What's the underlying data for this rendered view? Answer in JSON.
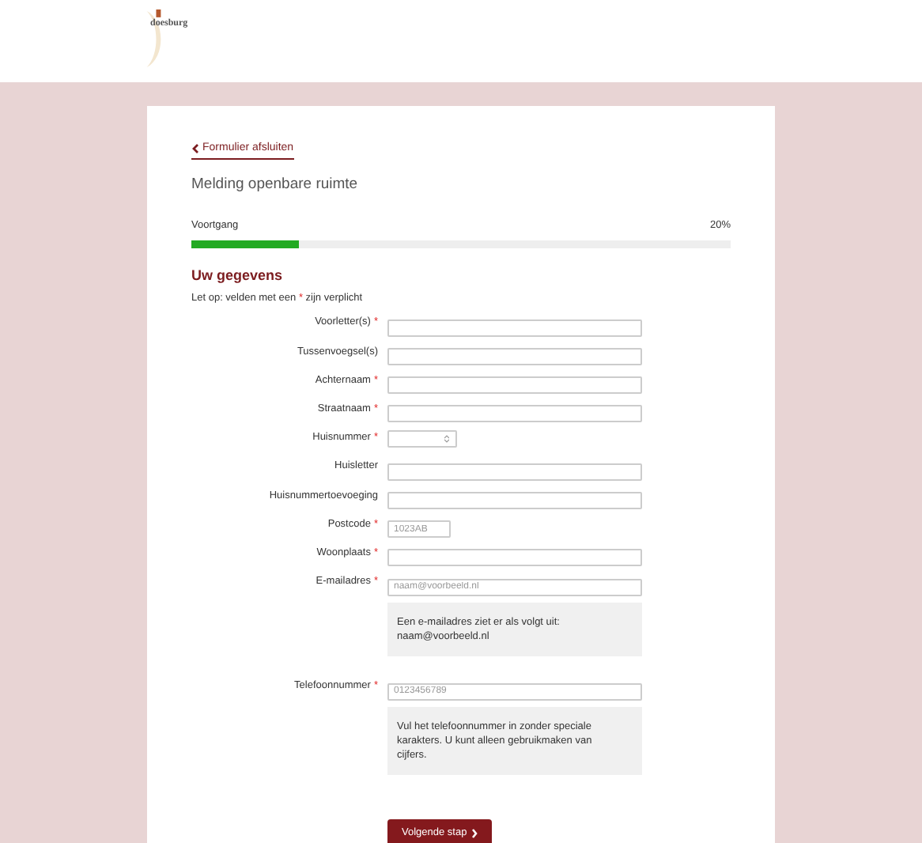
{
  "header": {
    "logo_text": "doesburg"
  },
  "back_link": "Formulier afsluiten",
  "form_title": "Melding openbare ruimte",
  "progress": {
    "label": "Voortgang",
    "reading": "20%",
    "level": 0.2
  },
  "section": {
    "title": "Uw gegevens",
    "note_before": "Let op: velden met een",
    "note_mark": "*",
    "note_after": "zijn verplicht"
  },
  "fields": [
    {
      "label": "Voorletter(s)",
      "required": true,
      "kind": "text"
    },
    {
      "label": "Tussenvoegsel(s)",
      "required": false,
      "kind": "text"
    },
    {
      "label": "Achternaam",
      "required": true,
      "kind": "text"
    },
    {
      "label": "Straatnaam",
      "required": true,
      "kind": "text"
    },
    {
      "label": "Huisnummer",
      "required": true,
      "kind": "number"
    },
    {
      "label": "Huisletter",
      "required": false,
      "kind": "text"
    },
    {
      "label": "Huisnummertoevoeging",
      "required": false,
      "kind": "text"
    },
    {
      "label": "Postcode",
      "required": true,
      "kind": "short",
      "placeholder": "1023AB"
    },
    {
      "label": "Woonplaats",
      "required": true,
      "kind": "text"
    },
    {
      "label": "E-mailadres",
      "required": true,
      "kind": "text",
      "placeholder": "naam@voorbeeld.nl",
      "hint": "Een e-mailadres ziet er als volgt uit: naam@voorbeeld.nl"
    },
    {
      "label": "Telefoonnummer",
      "required": true,
      "kind": "text",
      "placeholder": "0123456789",
      "hint": "Vul het telefoonnummer in zonder speciale karakters. U kunt alleen gebruikmaken van cijfers."
    }
  ],
  "next_button": "Volgende stap"
}
